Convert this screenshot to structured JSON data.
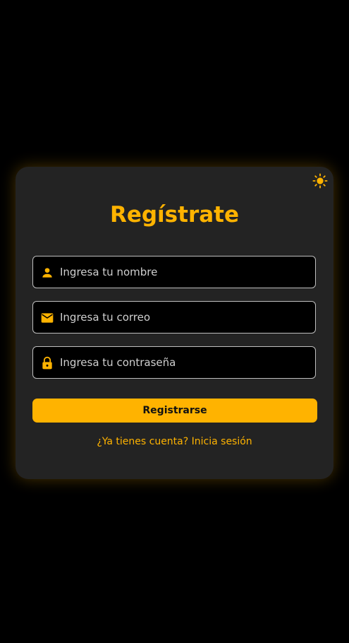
{
  "form": {
    "title": "Regístrate",
    "fields": [
      {
        "icon": "person-icon",
        "placeholder": "Ingresa tu nombre",
        "value": ""
      },
      {
        "icon": "mail-icon",
        "placeholder": "Ingresa tu correo",
        "value": ""
      },
      {
        "icon": "lock-icon",
        "placeholder": "Ingresa tu contraseña",
        "value": ""
      }
    ],
    "submit_label": "Registrarse",
    "login_prompt": "¿Ya tienes cuenta?",
    "login_link": "Inicia sesión"
  },
  "theme": {
    "toggle_icon": "sun-icon",
    "accent": "#ffb300",
    "card_bg": "#232323",
    "page_bg": "#000000"
  }
}
